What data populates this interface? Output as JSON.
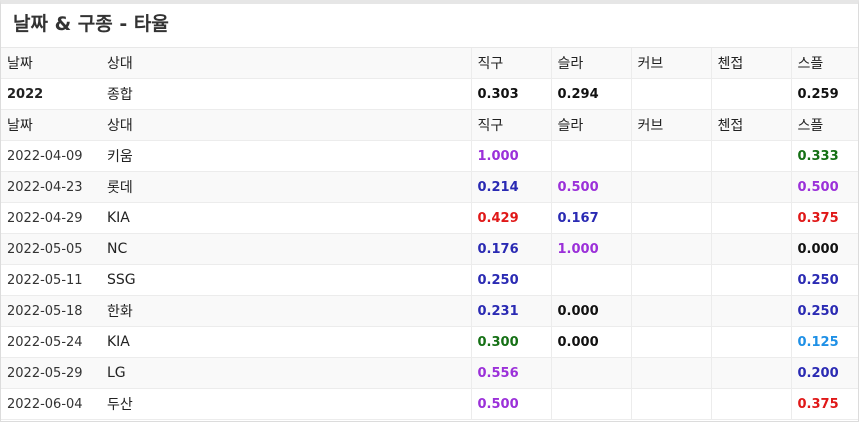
{
  "title": "날짜 & 구종 - 타율",
  "columns": [
    "날짜",
    "상대",
    "직구",
    "슬라",
    "커브",
    "첸접",
    "스플"
  ],
  "summary": {
    "date": "2022",
    "opponent": "종합",
    "values": [
      {
        "text": "0.303",
        "color": "black"
      },
      {
        "text": "0.294",
        "color": "black"
      },
      {
        "text": "",
        "color": "black"
      },
      {
        "text": "",
        "color": "black"
      },
      {
        "text": "0.259",
        "color": "black"
      }
    ]
  },
  "rows": [
    {
      "date": "2022-04-09",
      "opponent": "키움",
      "values": [
        {
          "text": "1.000",
          "color": "purple"
        },
        {
          "text": "",
          "color": ""
        },
        {
          "text": "",
          "color": ""
        },
        {
          "text": "",
          "color": ""
        },
        {
          "text": "0.333",
          "color": "green"
        }
      ]
    },
    {
      "date": "2022-04-23",
      "opponent": "롯데",
      "values": [
        {
          "text": "0.214",
          "color": "blue"
        },
        {
          "text": "0.500",
          "color": "purple"
        },
        {
          "text": "",
          "color": ""
        },
        {
          "text": "",
          "color": ""
        },
        {
          "text": "0.500",
          "color": "purple"
        }
      ]
    },
    {
      "date": "2022-04-29",
      "opponent": "KIA",
      "values": [
        {
          "text": "0.429",
          "color": "red"
        },
        {
          "text": "0.167",
          "color": "blue"
        },
        {
          "text": "",
          "color": ""
        },
        {
          "text": "",
          "color": ""
        },
        {
          "text": "0.375",
          "color": "red"
        }
      ]
    },
    {
      "date": "2022-05-05",
      "opponent": "NC",
      "values": [
        {
          "text": "0.176",
          "color": "blue"
        },
        {
          "text": "1.000",
          "color": "purple"
        },
        {
          "text": "",
          "color": ""
        },
        {
          "text": "",
          "color": ""
        },
        {
          "text": "0.000",
          "color": "black"
        }
      ]
    },
    {
      "date": "2022-05-11",
      "opponent": "SSG",
      "values": [
        {
          "text": "0.250",
          "color": "blue"
        },
        {
          "text": "",
          "color": ""
        },
        {
          "text": "",
          "color": ""
        },
        {
          "text": "",
          "color": ""
        },
        {
          "text": "0.250",
          "color": "blue"
        }
      ]
    },
    {
      "date": "2022-05-18",
      "opponent": "한화",
      "values": [
        {
          "text": "0.231",
          "color": "blue"
        },
        {
          "text": "0.000",
          "color": "black"
        },
        {
          "text": "",
          "color": ""
        },
        {
          "text": "",
          "color": ""
        },
        {
          "text": "0.250",
          "color": "blue"
        }
      ]
    },
    {
      "date": "2022-05-24",
      "opponent": "KIA",
      "values": [
        {
          "text": "0.300",
          "color": "green"
        },
        {
          "text": "0.000",
          "color": "black"
        },
        {
          "text": "",
          "color": ""
        },
        {
          "text": "",
          "color": ""
        },
        {
          "text": "0.125",
          "color": "sky"
        }
      ]
    },
    {
      "date": "2022-05-29",
      "opponent": "LG",
      "values": [
        {
          "text": "0.556",
          "color": "purple"
        },
        {
          "text": "",
          "color": ""
        },
        {
          "text": "",
          "color": ""
        },
        {
          "text": "",
          "color": ""
        },
        {
          "text": "0.200",
          "color": "blue"
        }
      ]
    },
    {
      "date": "2022-06-04",
      "opponent": "두산",
      "values": [
        {
          "text": "0.500",
          "color": "purple"
        },
        {
          "text": "",
          "color": ""
        },
        {
          "text": "",
          "color": ""
        },
        {
          "text": "",
          "color": ""
        },
        {
          "text": "0.375",
          "color": "red"
        }
      ]
    }
  ]
}
